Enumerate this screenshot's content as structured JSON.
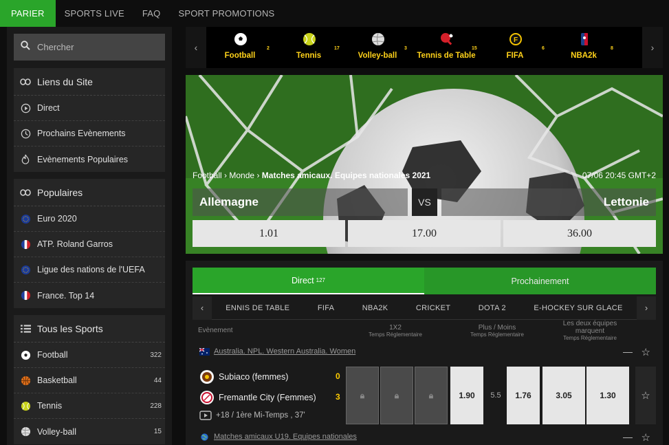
{
  "topnav": {
    "tabs": [
      "PARIER",
      "SPORTS LIVE",
      "FAQ",
      "SPORT PROMOTIONS"
    ]
  },
  "sidebar": {
    "search_placeholder": "Chercher",
    "site_links": {
      "title": "Liens du Site",
      "items": [
        "Direct",
        "Prochains Evènements",
        "Evènements Populaires"
      ]
    },
    "popular": {
      "title": "Populaires",
      "items": [
        "Euro 2020",
        "ATP. Roland Garros",
        "Ligue des nations de l'UEFA",
        "France. Top 14"
      ]
    },
    "all_sports": {
      "title": "Tous les Sports",
      "items": [
        {
          "label": "Football",
          "count": "322"
        },
        {
          "label": "Basketball",
          "count": "44"
        },
        {
          "label": "Tennis",
          "count": "228"
        },
        {
          "label": "Volley-ball",
          "count": "15"
        }
      ]
    }
  },
  "sportsbar": [
    {
      "label": "Football",
      "count": "2"
    },
    {
      "label": "Tennis",
      "count": "17"
    },
    {
      "label": "Volley-ball",
      "count": "3"
    },
    {
      "label": "Tennis de Table",
      "count": "15"
    },
    {
      "label": "FIFA",
      "count": "6"
    },
    {
      "label": "NBA2k",
      "count": "8"
    }
  ],
  "hero": {
    "crumb_1": "Football",
    "crumb_2": "Monde",
    "crumb_3": "Matches amicaux. Equipes nationales 2021",
    "sep": "›",
    "date": "07/06 20:45 GMT+2",
    "home": "Allemagne",
    "vs": "VS",
    "away": "Lettonie",
    "odds": [
      "1.01",
      "17.00",
      "36.00"
    ]
  },
  "panel": {
    "tab_direct": "Direct",
    "tab_direct_count": "127",
    "tab_next": "Prochainement",
    "subnav": [
      "ENNIS DE TABLE",
      "FIFA",
      "NBA2K",
      "CRICKET",
      "DOTA 2",
      "E-HOCKEY SUR GLACE"
    ],
    "col_event": "Evènement",
    "col_1x2": "1X2",
    "col_1x2_sub": "Temps Réglementaire",
    "col_ou": "Plus / Moins",
    "col_ou_sub": "Temps Réglementaire",
    "col_btts": "Les deux équipes marquent",
    "col_btts_sub": "Temps Réglementaire",
    "league_1": "Australia. NPL. Western Australia. Women",
    "team_1": "Subiaco (femmes)",
    "score_1": "0",
    "team_2": "Fremantle City (Femmes)",
    "score_2": "3",
    "match_info": "+18 / 1ère Mi-Temps , 37'",
    "ou_line": "5.5",
    "odds_values": [
      "1.90",
      "1.76",
      "3.05",
      "1.30"
    ],
    "league_2": "Matches amicaux U19. Equipes nationales"
  },
  "colors": {
    "accent": "#2aa52a",
    "sport_label": "#ffd21a",
    "score": "#ffcc00"
  }
}
